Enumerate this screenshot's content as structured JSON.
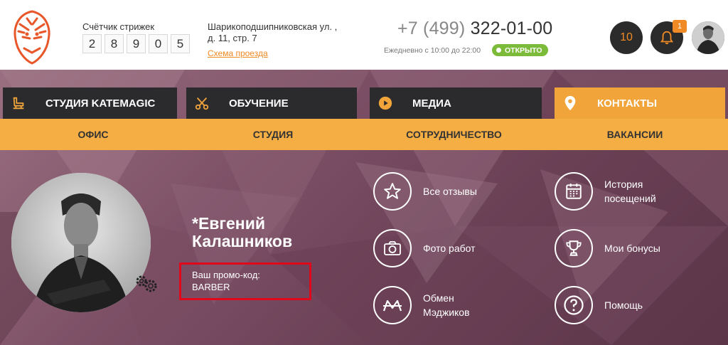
{
  "header": {
    "counter_label": "Счётчик стрижек",
    "counter_digits": [
      "2",
      "8",
      "9",
      "0",
      "5"
    ],
    "address_line1": "Шарикоподшипниковская ул. ,",
    "address_line2": "д. 11, стр. 7",
    "route_link": "Схема проезда",
    "phone_code": "+7 (499)",
    "phone_number": "322-01-00",
    "hours": "Ежедневно с 10:00 до 22:00",
    "status": "ОТКРЫТО",
    "counter_badge": "10",
    "notifications_count": "1"
  },
  "nav": [
    {
      "label": "СТУДИЯ KATEMAGIC",
      "icon": "barber-chair-icon"
    },
    {
      "label": "ОБУЧЕНИЕ",
      "icon": "scissors-icon"
    },
    {
      "label": "МЕДИА",
      "icon": "play-icon"
    },
    {
      "label": "КОНТАКТЫ",
      "icon": "location-pin-icon",
      "active": true
    }
  ],
  "subnav": [
    "ОФИС",
    "СТУДИЯ",
    "СОТРУДНИЧЕСТВО",
    "ВАКАНСИИ"
  ],
  "profile": {
    "name_line1": "*Евгений",
    "name_line2": "Калашников",
    "promo_label": "Ваш промо-код:",
    "promo_code": "BARBER"
  },
  "actions": {
    "reviews": "Все отзывы",
    "history_line1": "История",
    "history_line2": "посещений",
    "photos": "Фото работ",
    "bonuses": "Мои бонусы",
    "exchange_line1": "Обмен",
    "exchange_line2": "Мэджиков",
    "help": "Помощь"
  },
  "colors": {
    "accent": "#f0a43a",
    "dark": "#2b2b2e",
    "open_green": "#7cbb39",
    "promo_border": "#e0081a",
    "link": "#f08a24"
  }
}
